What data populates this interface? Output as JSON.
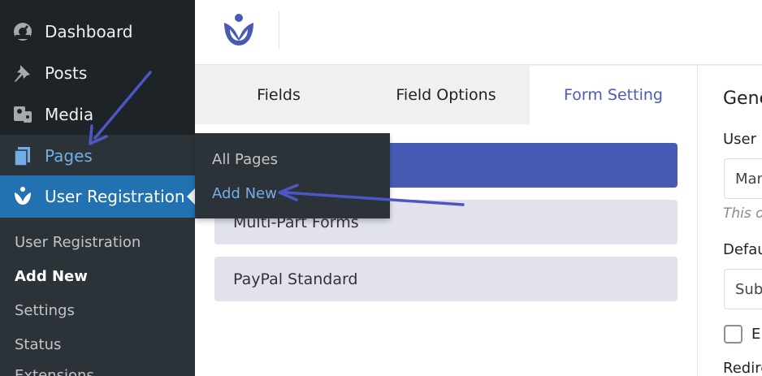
{
  "sidebar": {
    "items": [
      {
        "label": "Dashboard",
        "icon": "dashboard-icon"
      },
      {
        "label": "Posts",
        "icon": "pin-icon"
      },
      {
        "label": "Media",
        "icon": "media-icon"
      },
      {
        "label": "Pages",
        "icon": "pages-icon"
      },
      {
        "label": "User Registration",
        "icon": "user-registration-icon"
      }
    ],
    "submenu": [
      "User Registration",
      "Add New",
      "Settings",
      "Status",
      "Extensions"
    ],
    "submenu_active": "Add New"
  },
  "flyout": {
    "items": [
      "All Pages",
      "Add New"
    ],
    "highlighted": "Add New"
  },
  "builder": {
    "tabs": [
      "Fields",
      "Field Options",
      "Form Setting"
    ],
    "active_tab": "Form Setting",
    "buttons": [
      "",
      "Multi-Part Forms",
      "PayPal Standard"
    ]
  },
  "settings_panel": {
    "heading": "General",
    "user_label": "User l",
    "user_value": "Manual",
    "help_text": "This o",
    "default_label": "Defau",
    "default_value": "Submit",
    "checkbox_label": "En",
    "redirect_label": "Redire"
  },
  "colors": {
    "sidebar_bg": "#1d2327",
    "submenu_bg": "#2c3338",
    "active_menu": "#2271b1",
    "link_blue": "#72aee6",
    "brand": "#475bb5",
    "annotation_arrow": "#4c57c4"
  }
}
